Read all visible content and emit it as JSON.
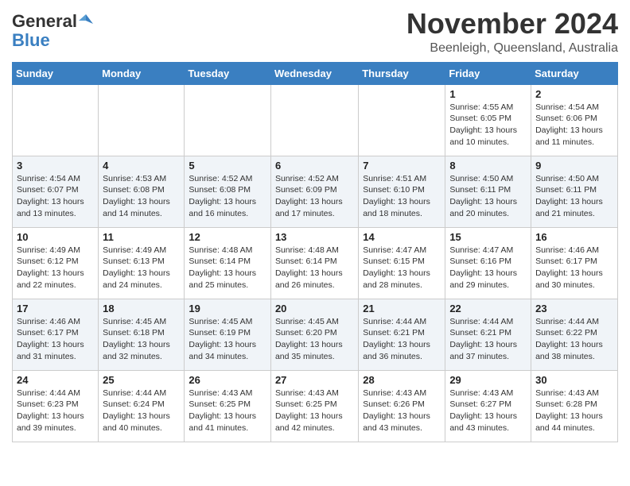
{
  "header": {
    "logo_general": "General",
    "logo_blue": "Blue",
    "month_title": "November 2024",
    "location": "Beenleigh, Queensland, Australia"
  },
  "weekdays": [
    "Sunday",
    "Monday",
    "Tuesday",
    "Wednesday",
    "Thursday",
    "Friday",
    "Saturday"
  ],
  "weeks": [
    [
      {
        "day": "",
        "info": ""
      },
      {
        "day": "",
        "info": ""
      },
      {
        "day": "",
        "info": ""
      },
      {
        "day": "",
        "info": ""
      },
      {
        "day": "",
        "info": ""
      },
      {
        "day": "1",
        "info": "Sunrise: 4:55 AM\nSunset: 6:05 PM\nDaylight: 13 hours and 10 minutes."
      },
      {
        "day": "2",
        "info": "Sunrise: 4:54 AM\nSunset: 6:06 PM\nDaylight: 13 hours and 11 minutes."
      }
    ],
    [
      {
        "day": "3",
        "info": "Sunrise: 4:54 AM\nSunset: 6:07 PM\nDaylight: 13 hours and 13 minutes."
      },
      {
        "day": "4",
        "info": "Sunrise: 4:53 AM\nSunset: 6:08 PM\nDaylight: 13 hours and 14 minutes."
      },
      {
        "day": "5",
        "info": "Sunrise: 4:52 AM\nSunset: 6:08 PM\nDaylight: 13 hours and 16 minutes."
      },
      {
        "day": "6",
        "info": "Sunrise: 4:52 AM\nSunset: 6:09 PM\nDaylight: 13 hours and 17 minutes."
      },
      {
        "day": "7",
        "info": "Sunrise: 4:51 AM\nSunset: 6:10 PM\nDaylight: 13 hours and 18 minutes."
      },
      {
        "day": "8",
        "info": "Sunrise: 4:50 AM\nSunset: 6:11 PM\nDaylight: 13 hours and 20 minutes."
      },
      {
        "day": "9",
        "info": "Sunrise: 4:50 AM\nSunset: 6:11 PM\nDaylight: 13 hours and 21 minutes."
      }
    ],
    [
      {
        "day": "10",
        "info": "Sunrise: 4:49 AM\nSunset: 6:12 PM\nDaylight: 13 hours and 22 minutes."
      },
      {
        "day": "11",
        "info": "Sunrise: 4:49 AM\nSunset: 6:13 PM\nDaylight: 13 hours and 24 minutes."
      },
      {
        "day": "12",
        "info": "Sunrise: 4:48 AM\nSunset: 6:14 PM\nDaylight: 13 hours and 25 minutes."
      },
      {
        "day": "13",
        "info": "Sunrise: 4:48 AM\nSunset: 6:14 PM\nDaylight: 13 hours and 26 minutes."
      },
      {
        "day": "14",
        "info": "Sunrise: 4:47 AM\nSunset: 6:15 PM\nDaylight: 13 hours and 28 minutes."
      },
      {
        "day": "15",
        "info": "Sunrise: 4:47 AM\nSunset: 6:16 PM\nDaylight: 13 hours and 29 minutes."
      },
      {
        "day": "16",
        "info": "Sunrise: 4:46 AM\nSunset: 6:17 PM\nDaylight: 13 hours and 30 minutes."
      }
    ],
    [
      {
        "day": "17",
        "info": "Sunrise: 4:46 AM\nSunset: 6:17 PM\nDaylight: 13 hours and 31 minutes."
      },
      {
        "day": "18",
        "info": "Sunrise: 4:45 AM\nSunset: 6:18 PM\nDaylight: 13 hours and 32 minutes."
      },
      {
        "day": "19",
        "info": "Sunrise: 4:45 AM\nSunset: 6:19 PM\nDaylight: 13 hours and 34 minutes."
      },
      {
        "day": "20",
        "info": "Sunrise: 4:45 AM\nSunset: 6:20 PM\nDaylight: 13 hours and 35 minutes."
      },
      {
        "day": "21",
        "info": "Sunrise: 4:44 AM\nSunset: 6:21 PM\nDaylight: 13 hours and 36 minutes."
      },
      {
        "day": "22",
        "info": "Sunrise: 4:44 AM\nSunset: 6:21 PM\nDaylight: 13 hours and 37 minutes."
      },
      {
        "day": "23",
        "info": "Sunrise: 4:44 AM\nSunset: 6:22 PM\nDaylight: 13 hours and 38 minutes."
      }
    ],
    [
      {
        "day": "24",
        "info": "Sunrise: 4:44 AM\nSunset: 6:23 PM\nDaylight: 13 hours and 39 minutes."
      },
      {
        "day": "25",
        "info": "Sunrise: 4:44 AM\nSunset: 6:24 PM\nDaylight: 13 hours and 40 minutes."
      },
      {
        "day": "26",
        "info": "Sunrise: 4:43 AM\nSunset: 6:25 PM\nDaylight: 13 hours and 41 minutes."
      },
      {
        "day": "27",
        "info": "Sunrise: 4:43 AM\nSunset: 6:25 PM\nDaylight: 13 hours and 42 minutes."
      },
      {
        "day": "28",
        "info": "Sunrise: 4:43 AM\nSunset: 6:26 PM\nDaylight: 13 hours and 43 minutes."
      },
      {
        "day": "29",
        "info": "Sunrise: 4:43 AM\nSunset: 6:27 PM\nDaylight: 13 hours and 43 minutes."
      },
      {
        "day": "30",
        "info": "Sunrise: 4:43 AM\nSunset: 6:28 PM\nDaylight: 13 hours and 44 minutes."
      }
    ]
  ]
}
